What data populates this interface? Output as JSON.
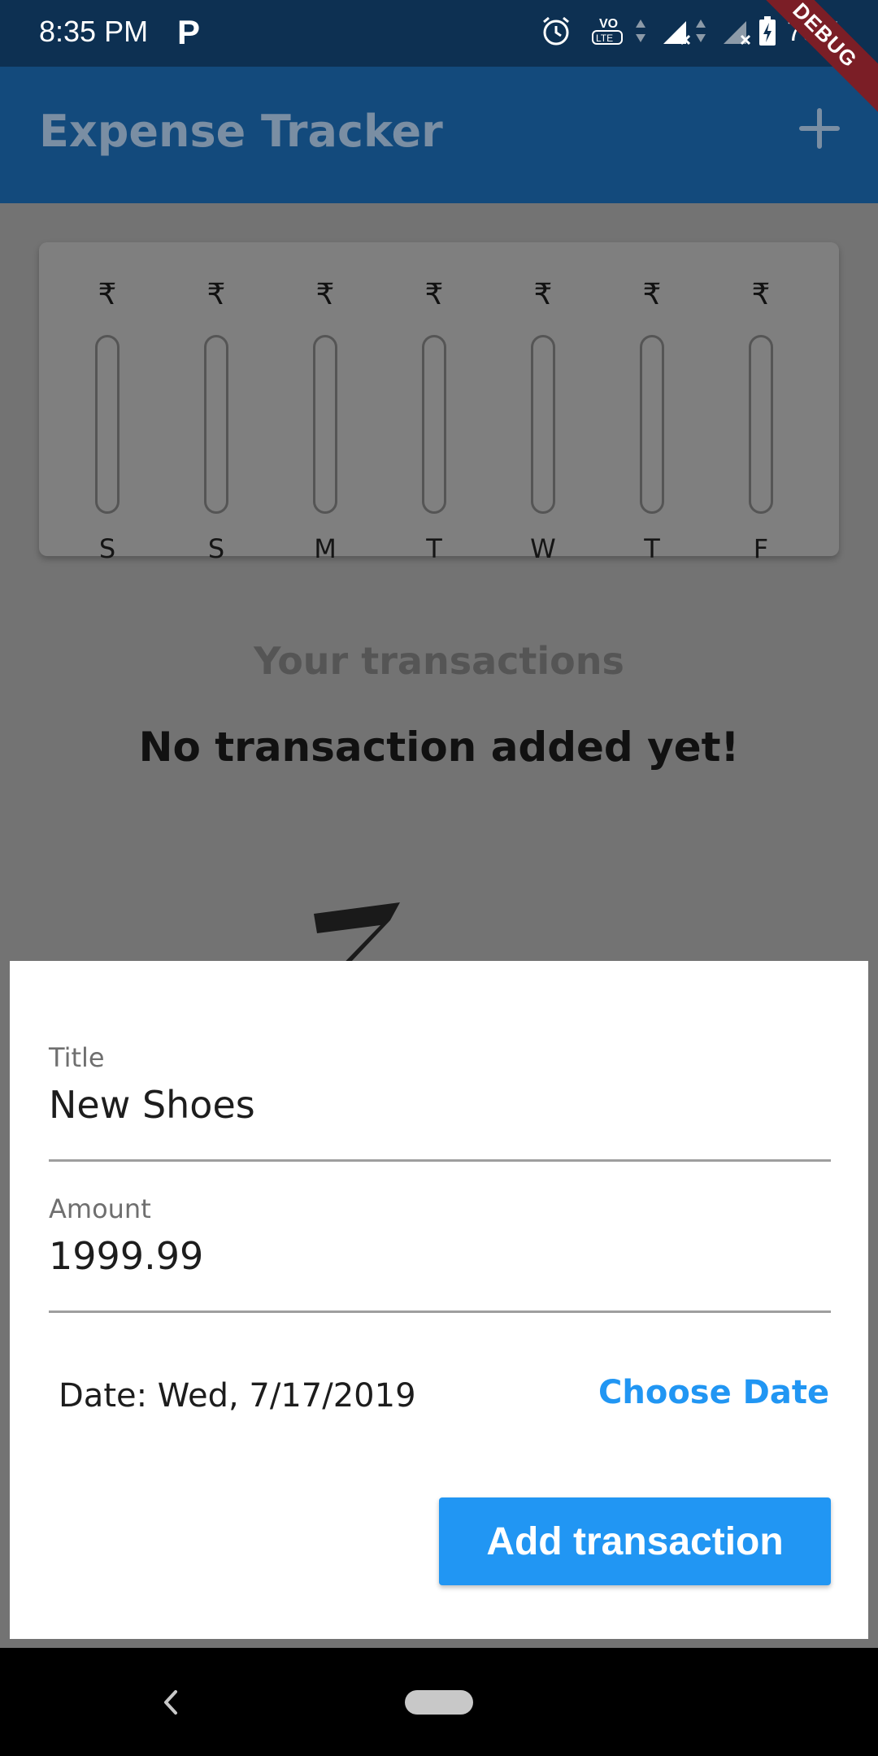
{
  "status_bar": {
    "time": "8:35 PM",
    "app_indicator": "P",
    "battery_percent": "79%",
    "icons": [
      "alarm-icon",
      "volte-icon",
      "signal-icon",
      "signal-icon",
      "battery-charging-icon"
    ]
  },
  "debug_banner": "DEBUG",
  "app_bar": {
    "title": "Expense Tracker",
    "add_icon": "plus-icon"
  },
  "chart": {
    "currency_symbol": "₹",
    "days": [
      "S",
      "S",
      "M",
      "T",
      "W",
      "T",
      "F"
    ],
    "fill_fractions": [
      0,
      0,
      0,
      0,
      0,
      0,
      0
    ]
  },
  "transactions": {
    "heading": "Your transactions",
    "empty_message": "No transaction added yet!",
    "empty_image_icon": "zz-sleep-icon"
  },
  "form": {
    "title_label": "Title",
    "title_value": "New Shoes",
    "amount_label": "Amount",
    "amount_value": "1999.99",
    "date_text": "Date:  Wed, 7/17/2019",
    "choose_date_label": "Choose Date",
    "submit_label": "Add transaction"
  },
  "colors": {
    "status_bar": "#0d3052",
    "app_bar": "#134a7c",
    "accent": "#2196f3",
    "debug": "#7b1e26"
  },
  "nav": {
    "back_icon": "back-chevron-icon",
    "home_icon": "home-pill-icon"
  }
}
